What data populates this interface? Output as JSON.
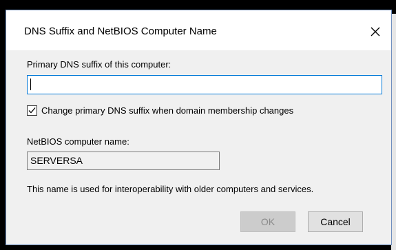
{
  "dialog": {
    "title": "DNS Suffix and NetBIOS Computer Name",
    "close_icon": "close-icon"
  },
  "dns": {
    "label": "Primary DNS suffix of this computer:",
    "value": "",
    "placeholder": ""
  },
  "checkbox": {
    "checked": true,
    "label": "Change primary DNS suffix when domain membership changes"
  },
  "netbios": {
    "label": "NetBIOS computer name:",
    "value": "SERVERSA"
  },
  "note": "This name is used for interoperability with older computers and services.",
  "buttons": {
    "ok_label": "OK",
    "cancel_label": "Cancel"
  },
  "colors": {
    "focus_border": "#0078d7",
    "dialog_bg": "#f0f0f0",
    "disabled_text": "#8a8a8a"
  }
}
